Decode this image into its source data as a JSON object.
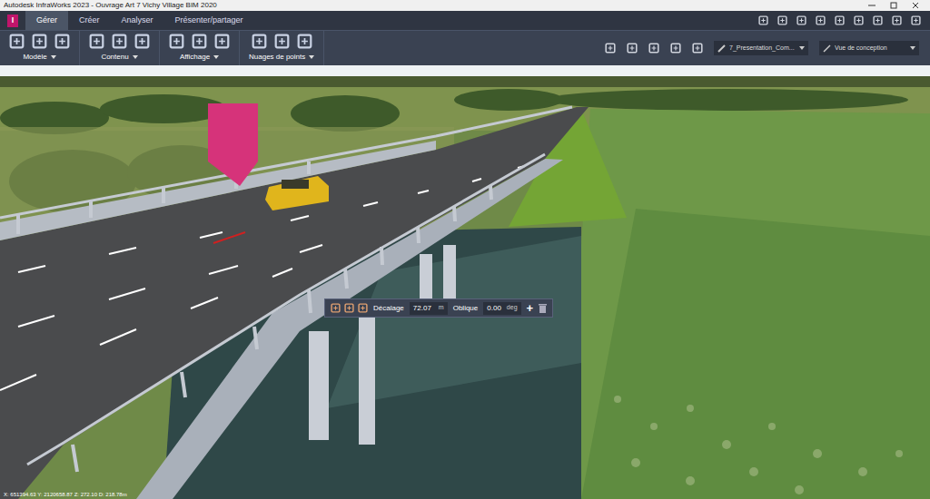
{
  "window": {
    "title": "Autodesk InfraWorks 2023 - Ouvrage Art 7 Vichy Village BIM 2020"
  },
  "app_logo": "I",
  "tabs": [
    {
      "label": "Gérer",
      "selected": true
    },
    {
      "label": "Créer",
      "selected": false
    },
    {
      "label": "Analyser",
      "selected": false
    },
    {
      "label": "Présenter/partager",
      "selected": false
    }
  ],
  "ribbon_groups": [
    {
      "label": "Modèle"
    },
    {
      "label": "Contenu"
    },
    {
      "label": "Affichage"
    },
    {
      "label": "Nuages de points"
    }
  ],
  "proposal": "7_Presentation_Com...",
  "view_mode": "Vue de conception",
  "offset_toolbar": {
    "offset_label": "Décalage",
    "offset_value": "72.07",
    "offset_unit": "m",
    "skew_label": "Oblique",
    "skew_value": "0.00",
    "skew_unit": "deg",
    "add": "+"
  },
  "status_bar": {
    "coordinates": "X: 651394.63 Y: 2120658.87 Z: 272.10 D: 218.78m"
  }
}
